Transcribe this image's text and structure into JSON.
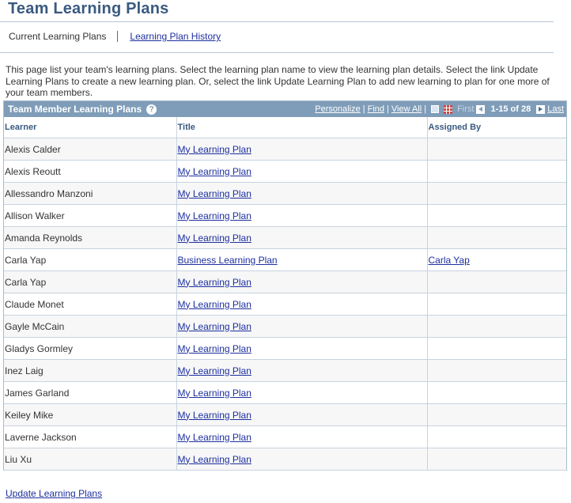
{
  "page": {
    "title": "Team Learning Plans",
    "tab_current": "Current Learning Plans",
    "tab_history": "Learning Plan History",
    "intro": "This page list your team's learning plans.  Select the learning plan name to view the learning plan details.  Select the link Update Learning Plans to create a new learning plan. Or, select the link Update Learning Plan to add new learning to plan for one more of your team members."
  },
  "grid": {
    "title": "Team Member Learning Plans",
    "help_icon": "question-icon",
    "nav": {
      "personalize": "Personalize",
      "find": "Find",
      "view_all": "View All",
      "first": "First",
      "count": "1-15 of 28",
      "last": "Last"
    },
    "columns": [
      "Learner",
      "Title",
      "Assigned By"
    ],
    "rows": [
      {
        "learner": "Alexis Calder",
        "title": "My Learning Plan",
        "assigned_by": ""
      },
      {
        "learner": "Alexis Reoutt",
        "title": "My Learning Plan",
        "assigned_by": ""
      },
      {
        "learner": "Allessandro Manzoni",
        "title": "My Learning Plan",
        "assigned_by": ""
      },
      {
        "learner": "Allison Walker",
        "title": "My Learning Plan",
        "assigned_by": ""
      },
      {
        "learner": "Amanda Reynolds",
        "title": "My Learning Plan",
        "assigned_by": ""
      },
      {
        "learner": "Carla Yap",
        "title": "Business Learning Plan",
        "assigned_by": "Carla Yap"
      },
      {
        "learner": "Carla Yap",
        "title": "My Learning Plan",
        "assigned_by": ""
      },
      {
        "learner": "Claude Monet",
        "title": "My Learning Plan",
        "assigned_by": ""
      },
      {
        "learner": "Gayle McCain",
        "title": "My Learning Plan",
        "assigned_by": ""
      },
      {
        "learner": "Gladys Gormley",
        "title": "My Learning Plan",
        "assigned_by": ""
      },
      {
        "learner": "Inez Laig",
        "title": "My Learning Plan",
        "assigned_by": ""
      },
      {
        "learner": "James Garland",
        "title": "My Learning Plan",
        "assigned_by": ""
      },
      {
        "learner": "Keiley Mike",
        "title": "My Learning Plan",
        "assigned_by": ""
      },
      {
        "learner": "Laverne Jackson",
        "title": "My Learning Plan",
        "assigned_by": ""
      },
      {
        "learner": "Liu Xu",
        "title": "My Learning Plan",
        "assigned_by": ""
      }
    ]
  },
  "footer": {
    "update_link": "Update Learning Plans"
  },
  "colors": {
    "header_bg": "#7f9db9",
    "title": "#3a5a80",
    "link": "#1d2f9e"
  }
}
